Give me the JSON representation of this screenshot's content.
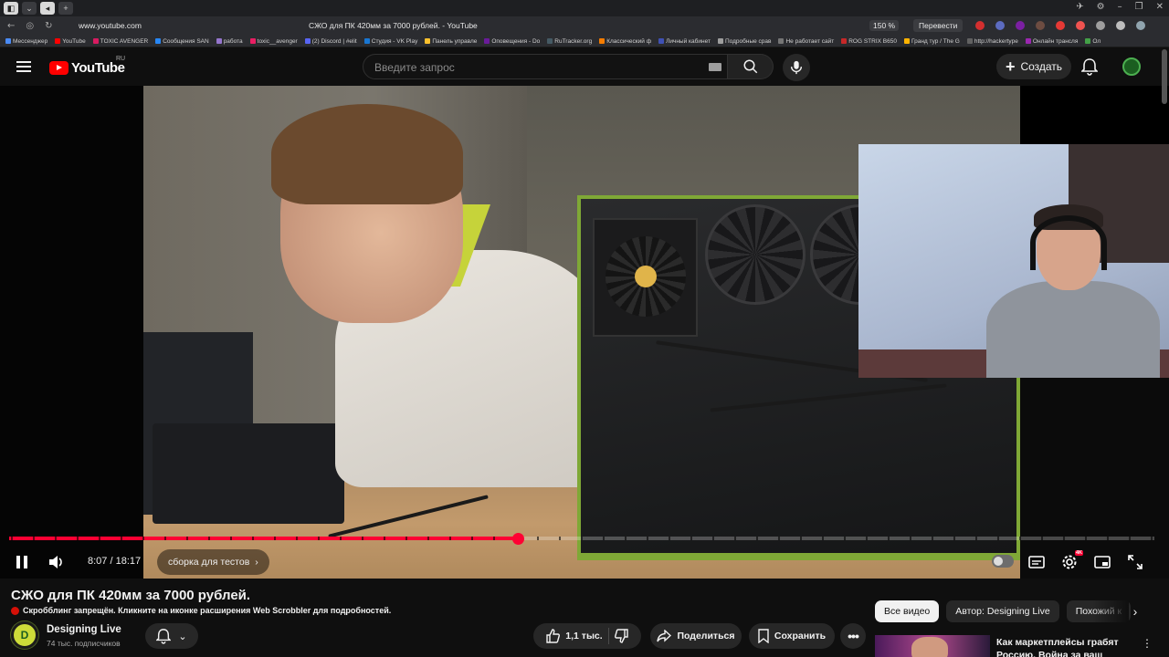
{
  "browser": {
    "url": "www.youtube.com",
    "page_title": "СЖО для ПК 420мм за 7000 рублей. - YouTube",
    "zoom": "150 %",
    "translate_label": "Перевести",
    "bookmarks": [
      "Мессенджер",
      "YouTube",
      "TOXIC AVENGER",
      "Сообщения SAN",
      "работа",
      "toxic__avenger",
      "(2) Discord | #elit",
      "Студия - VK Play",
      "Панель управле",
      "Оповещения - Do",
      "RuTracker.org",
      "Классический ф",
      "Личный кабинет",
      "Подробные срав",
      "Не работает сайт",
      "ROG STRIX B650",
      "Гранд тур / The G",
      "http://hackertype",
      "Онлайн трансля",
      "Ол"
    ]
  },
  "header": {
    "logo_text": "YouTube",
    "logo_region": "RU",
    "search_placeholder": "Введите запрос",
    "create_label": "Создать"
  },
  "player": {
    "current_time": "8:07",
    "duration": "18:17",
    "time_display": "8:07 / 18:17",
    "progress_fraction": 0.4439,
    "chapter_label": "сборка для тестов",
    "hd_badge": "4K"
  },
  "video": {
    "title": "СЖО для ПК 420мм за 7000 рублей.",
    "scrobbler_notice": "Скробблинг запрещён. Кликните на иконке расширения Web Scrobbler для подробностей.",
    "channel_name": "Designing Live",
    "subscribers": "74 тыс. подписчиков",
    "likes": "1,1 тыс.",
    "share_label": "Поделиться",
    "save_label": "Сохранить"
  },
  "sidebar": {
    "chips": [
      "Все видео",
      "Автор: Designing Live",
      "Похожий к"
    ],
    "recommendation_title": "Как маркетплейсы грабят Россию. Война за ваш"
  },
  "colors": {
    "accent": "#ff0033",
    "background": "#0f0f0f",
    "chip_active": "#f1f1f1"
  }
}
